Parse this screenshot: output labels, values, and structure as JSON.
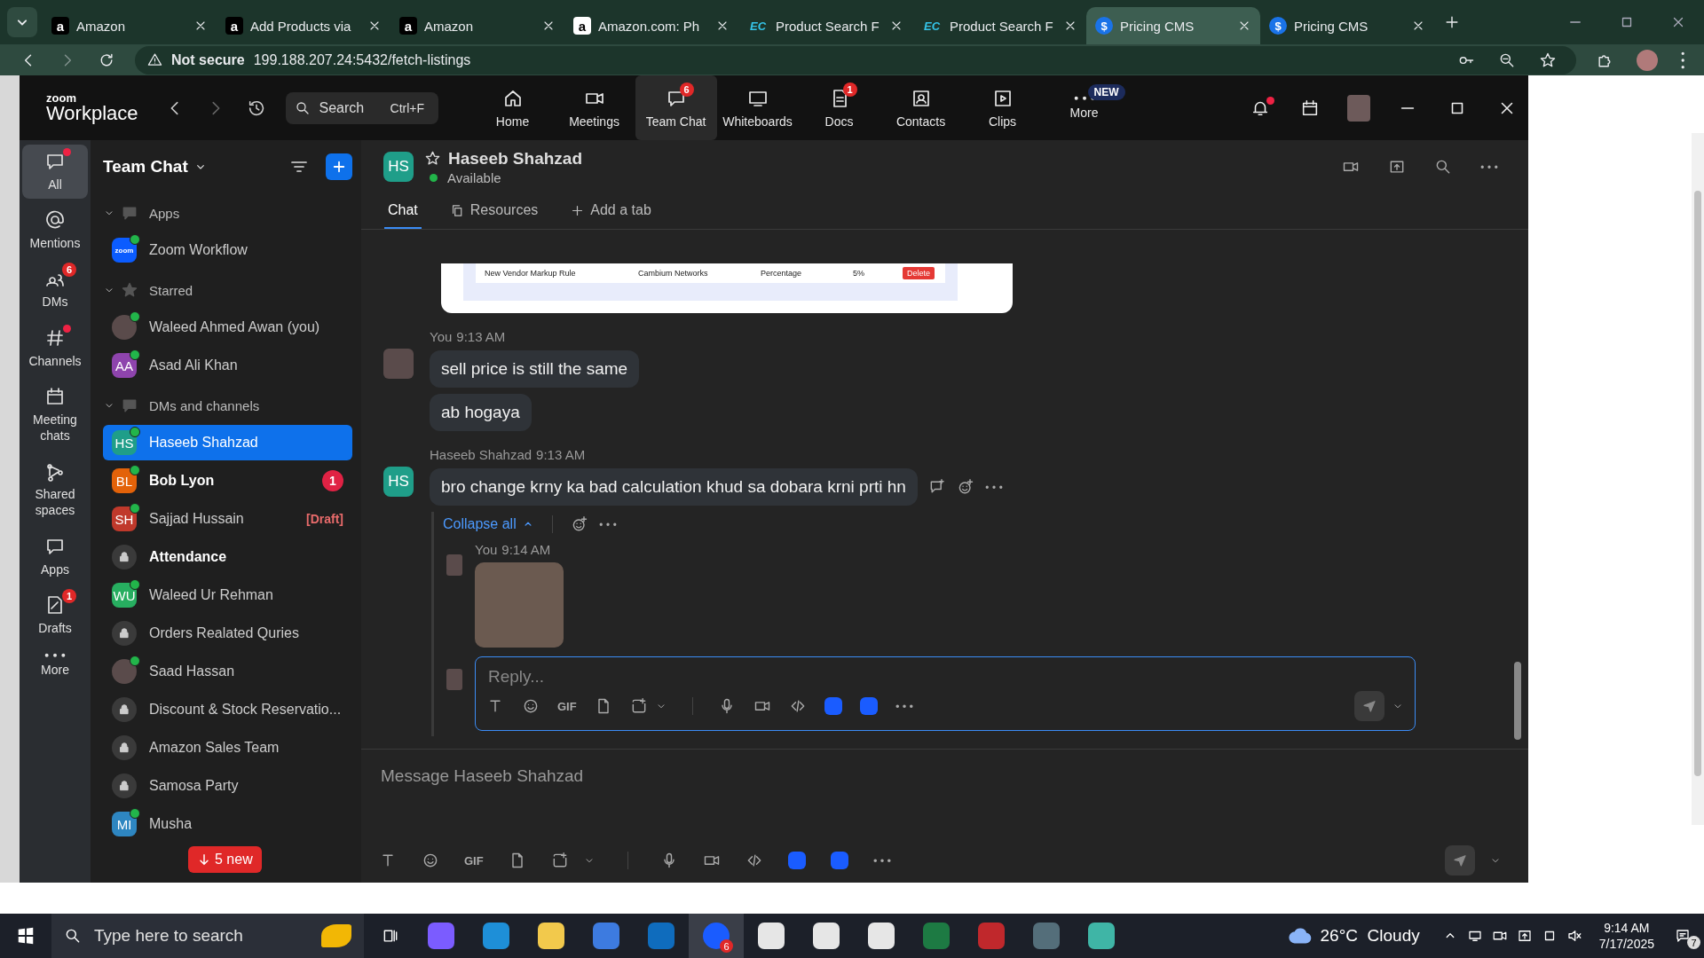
{
  "browser": {
    "tabs": [
      {
        "title": "Amazon",
        "favicon": "a",
        "kind": "letter",
        "selected": false
      },
      {
        "title": "Add Products via",
        "favicon": "a",
        "kind": "letter",
        "selected": false
      },
      {
        "title": "Amazon",
        "favicon": "a",
        "kind": "letter",
        "selected": false
      },
      {
        "title": "Amazon.com: Ph",
        "favicon": "a",
        "kind": "letter-light",
        "selected": false
      },
      {
        "title": "Product Search F",
        "favicon": "EC",
        "kind": "ec",
        "selected": false
      },
      {
        "title": "Product Search F",
        "favicon": "EC",
        "kind": "ec",
        "selected": false
      },
      {
        "title": "Pricing CMS",
        "favicon": "$",
        "kind": "dollar",
        "selected": true
      },
      {
        "title": "Pricing CMS",
        "favicon": "$",
        "kind": "dollar",
        "selected": false
      }
    ],
    "address": {
      "security": "Not secure",
      "url": "199.188.207.24:5432/fetch-listings"
    }
  },
  "zoom": {
    "logo_top": "zoom",
    "logo_bottom": "Workplace",
    "search": {
      "placeholder": "Search",
      "shortcut": "Ctrl+F"
    },
    "nav": [
      {
        "label": "Home",
        "selected": false
      },
      {
        "label": "Meetings",
        "selected": false
      },
      {
        "label": "Team Chat",
        "selected": true,
        "badge": "6"
      },
      {
        "label": "Whiteboards",
        "selected": false
      },
      {
        "label": "Docs",
        "selected": false,
        "badge": "1"
      },
      {
        "label": "Contacts",
        "selected": false
      },
      {
        "label": "Clips",
        "selected": false
      },
      {
        "label": "More",
        "selected": false,
        "tag": "NEW"
      }
    ],
    "notification_dot": true
  },
  "rail": [
    {
      "label": "All",
      "selected": true,
      "dot": true
    },
    {
      "label": "Mentions",
      "selected": false,
      "dot": false
    },
    {
      "label": "DMs",
      "selected": false,
      "dot": false,
      "badge": "6"
    },
    {
      "label": "Channels",
      "selected": false,
      "dot": true
    },
    {
      "label": "Meeting chats",
      "selected": false,
      "dot": false
    },
    {
      "label": "Shared spaces",
      "selected": false,
      "dot": false
    },
    {
      "label": "Apps",
      "selected": false,
      "dot": false
    },
    {
      "label": "Drafts",
      "selected": false,
      "dot": false,
      "badge": "1"
    },
    {
      "label": "More",
      "selected": false,
      "dot": false
    }
  ],
  "sidebar": {
    "title": "Team Chat",
    "new_messages": "5 new",
    "sections": [
      {
        "title": "Apps",
        "expanded": true,
        "items": [
          {
            "name": "Zoom Workflow",
            "kind": "app",
            "initials": "zoom",
            "color": "#0b5cff",
            "online": true,
            "unread": false,
            "selected": false
          }
        ]
      },
      {
        "title": "Starred",
        "expanded": true,
        "items": [
          {
            "name": "Waleed Ahmed Awan (you)",
            "kind": "photo",
            "online": true,
            "unread": false,
            "selected": false
          },
          {
            "name": "Asad Ali Khan",
            "kind": "initials",
            "initials": "AA",
            "color": "#8e44ad",
            "online": true,
            "unread": false,
            "selected": false
          }
        ]
      },
      {
        "title": "DMs and channels",
        "expanded": true,
        "items": [
          {
            "name": "Haseeb Shahzad",
            "kind": "initials",
            "initials": "HS",
            "color": "#1f9e89",
            "online": true,
            "unread": false,
            "selected": true
          },
          {
            "name": "Bob Lyon",
            "kind": "initials",
            "initials": "BL",
            "color": "#e36209",
            "online": true,
            "unread": true,
            "selected": false,
            "badge": "1"
          },
          {
            "name": "Sajjad Hussain",
            "kind": "initials",
            "initials": "SH",
            "color": "#c0392b",
            "online": true,
            "unread": false,
            "selected": false,
            "draft": "[Draft]"
          },
          {
            "name": "Attendance",
            "kind": "lock",
            "online": false,
            "unread": true,
            "selected": false
          },
          {
            "name": "Waleed Ur Rehman",
            "kind": "initials",
            "initials": "WU",
            "color": "#27ae60",
            "online": true,
            "unread": false,
            "selected": false
          },
          {
            "name": "Orders Realated Quries",
            "kind": "lock",
            "online": false,
            "unread": false,
            "selected": false
          },
          {
            "name": "Saad Hassan",
            "kind": "photo",
            "online": true,
            "unread": false,
            "selected": false
          },
          {
            "name": "Discount & Stock Reservatio...",
            "kind": "lock",
            "online": false,
            "unread": false,
            "selected": false
          },
          {
            "name": "Amazon Sales Team",
            "kind": "lock",
            "online": false,
            "unread": false,
            "selected": false
          },
          {
            "name": "Samosa Party",
            "kind": "lock",
            "online": false,
            "unread": false,
            "selected": false
          },
          {
            "name": "Musha",
            "kind": "initials",
            "initials": "MI",
            "color": "#2e86c1",
            "online": true,
            "unread": false,
            "selected": false
          }
        ]
      }
    ]
  },
  "chat": {
    "initials": "HS",
    "color": "#1f9e89",
    "name": "Haseeb Shahzad",
    "status": "Available",
    "online": true,
    "tabs": [
      {
        "label": "Chat",
        "kind": "chat",
        "selected": true
      },
      {
        "label": "Resources",
        "kind": "resources",
        "selected": false
      },
      {
        "label": "Add a tab",
        "kind": "add",
        "selected": false
      }
    ],
    "messages": [
      {
        "kind": "attachment",
        "cells": [
          "New Vendor Markup Rule",
          "Cambium Networks",
          "Percentage",
          "5%"
        ],
        "action": "Delete"
      },
      {
        "kind": "group",
        "sender": "You",
        "time": "9:13 AM",
        "bubbles": [
          "sell price is still the same",
          "ab hogaya"
        ]
      },
      {
        "kind": "group",
        "sender": "Haseeb Shahzad",
        "time": "9:13 AM",
        "initials": "HS",
        "color": "#1f9e89",
        "bubbles": [
          "bro change krny ka bad calculation khud sa dobara krni prti hn"
        ],
        "thread": {
          "collapse_label": "Collapse all",
          "expanded": true,
          "replies": [
            {
              "sender": "You",
              "time": "9:14 AM",
              "kind": "image"
            }
          ],
          "reply_box": {
            "placeholder": "Reply...",
            "gif_label": "GIF",
            "focused": true
          }
        }
      }
    ],
    "composer": {
      "placeholder": "Message Haseeb Shahzad",
      "gif_label": "GIF"
    }
  },
  "taskbar": {
    "search_placeholder": "Type here to search",
    "app_badge": "6",
    "weather": "26°C  Cloudy",
    "time": "9:14 AM",
    "date": "7/17/2025",
    "notifications": "7"
  }
}
